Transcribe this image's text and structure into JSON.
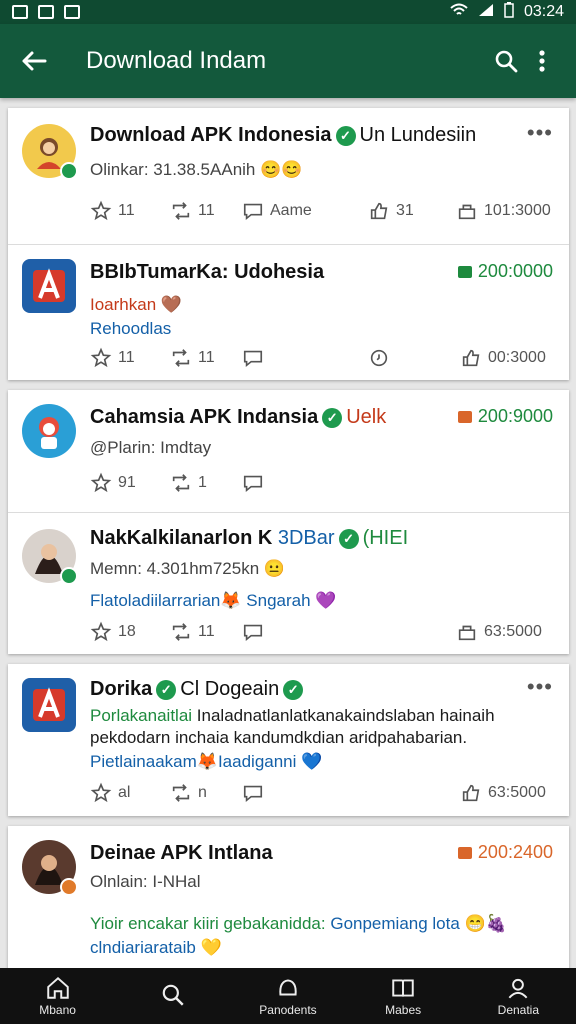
{
  "status_bar": {
    "time": "03:24"
  },
  "app_bar": {
    "title": "Download Indam"
  },
  "posts": [
    {
      "name": "Download APK Indonesia",
      "name_extra": "Un Lundesiin",
      "sub": "Olinkar: 31.38.5AAnih",
      "actions": [
        "11",
        "11",
        "Aame",
        "31",
        "101:3000"
      ]
    },
    {
      "name": "BBIbTumarKa: Udohesia",
      "price": "200:0000",
      "line1": "Ioarhkan",
      "line2": "Rehoodlas",
      "actions": [
        "11",
        "11",
        "",
        "",
        "00:3000"
      ]
    },
    {
      "name": "Cahamsia APK Indansia",
      "name_extra": "Uelk",
      "price": "200:9000",
      "sub": "@Plarin: Imdtay",
      "actions": [
        "91",
        "1",
        ""
      ]
    },
    {
      "name": "NakKalkilanarlon K",
      "name_extra": "3DBar",
      "name_extra2": "(HIEI",
      "sub": "Memn: 4.301hm725kn",
      "line1": "Flatoladiilarrarian",
      "line1b": "Sngarah",
      "actions": [
        "18",
        "11",
        "",
        "63:5000"
      ]
    },
    {
      "name": "Dorika",
      "name_extra": "Cl Dogeain",
      "line1a": "Porlakanaitlai",
      "line1b": "Inaladnatlanlatkanakaindslaban hainaih",
      "line2": "pekdodarn inchaia kandumdkdian aridpahabarian.",
      "line3": "Pietlainaakam",
      "line3b": "Iaadiganni",
      "actions": [
        "al",
        "n",
        "",
        "63:5000"
      ]
    },
    {
      "name": "Deinae APK Intlana",
      "price": "200:2400",
      "sub": "Olnlain: I-NHal",
      "line1": "Yioir encakar kiiri gebakanidda:",
      "line1b": "Gonpemiang lota",
      "line2": "clndiariarataib"
    }
  ],
  "bottom_nav": [
    {
      "label": "Mbano",
      "icon": "home-icon"
    },
    {
      "label": "",
      "icon": "search-icon"
    },
    {
      "label": "Panodents",
      "icon": "circle-icon"
    },
    {
      "label": "Mabes",
      "icon": "book-icon"
    },
    {
      "label": "Denatia",
      "icon": "profile-icon"
    }
  ],
  "colors": {
    "app_bar": "#13593c",
    "verified": "#1e9a4e",
    "price_green": "#1e8a3e",
    "price_orange": "#d9662a"
  }
}
